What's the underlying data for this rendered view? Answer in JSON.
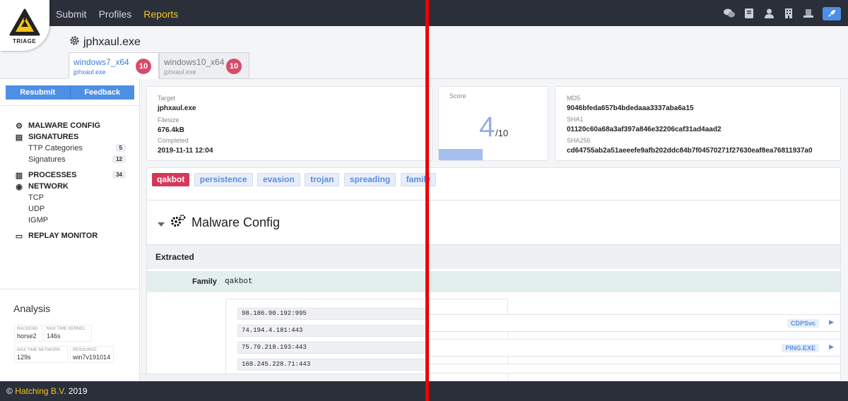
{
  "nav": {
    "items": [
      "Submit",
      "Profiles",
      "Reports"
    ],
    "active": "Reports"
  },
  "logo": {
    "text": "TRIAGE"
  },
  "topbar": {
    "icons": [
      "chat-icon",
      "book-icon",
      "user-icon",
      "building-icon",
      "desk-icon",
      "rocket-icon"
    ],
    "accent": "#4e8fe6"
  },
  "file": {
    "name": "jphxaul.exe"
  },
  "tabs": [
    {
      "title": "windows7_x64",
      "sub": "jphxaul.exe",
      "score": "10"
    },
    {
      "title": "windows10_x64",
      "sub": "jphxaul.exe",
      "score": "10"
    }
  ],
  "sidebar": {
    "resubmit": "Resubmit",
    "feedback": "Feedback",
    "menu": {
      "malware_config": "MALWARE CONFIG",
      "signatures": "SIGNATURES",
      "ttp": "TTP Categories",
      "ttp_count": "5",
      "sigs": "Signatures",
      "sigs_count": "12",
      "processes": "PROCESSES",
      "processes_count": "34",
      "network": "NETWORK",
      "tcp": "TCP",
      "udp": "UDP",
      "igmp": "IGMP",
      "replay": "REPLAY MONITOR"
    },
    "analysis": {
      "title": "Analysis",
      "backend_k": "BACKEND",
      "backend_v": "horse2",
      "kernel_k": "MAX TIME KERNEL",
      "kernel_v": "146s",
      "network_k": "MAX TIME NETWORK",
      "network_v": "129s",
      "resource_k": "RESOURCE",
      "resource_v": "win7v191014"
    }
  },
  "target": {
    "target_k": "Target",
    "target_v": "jphxaul.exe",
    "size_k": "Filesize",
    "size_v": "676.4kB",
    "completed_k": "Completed",
    "completed_v": "2019-11-11 12:04"
  },
  "score": {
    "label": "Score",
    "value": "4",
    "max": "/10",
    "fraction": 0.4
  },
  "hashes": {
    "md5_k": "MD5",
    "md5_v": "9046bfeda657b4bdedaaa3337aba6a15",
    "sha1_k": "SHA1",
    "sha1_v": "01120c60a68a3af397a846e32206caf31ad4aad2",
    "sha256_k": "SHA256",
    "sha256_v": "cd64755ab2a51aeeefe9afb202ddc84b7f04570271f27630eaf8ea76811937a0"
  },
  "tags": [
    "qakbot",
    "persistence",
    "evasion",
    "trojan",
    "spreading",
    "family"
  ],
  "config": {
    "title": "Malware Config",
    "extracted": "Extracted",
    "family_k": "Family",
    "family_v": "qakbot",
    "ips": [
      "98.186.90.192:995",
      "74.194.4.181:443",
      "75.70.218.193:443",
      "168.245.228.71:443"
    ]
  },
  "right_chips": [
    "CDPSvc",
    "PING.EXE"
  ],
  "footer": {
    "copy": "©",
    "brand": "Hatching B.V.",
    "year": "2019"
  }
}
